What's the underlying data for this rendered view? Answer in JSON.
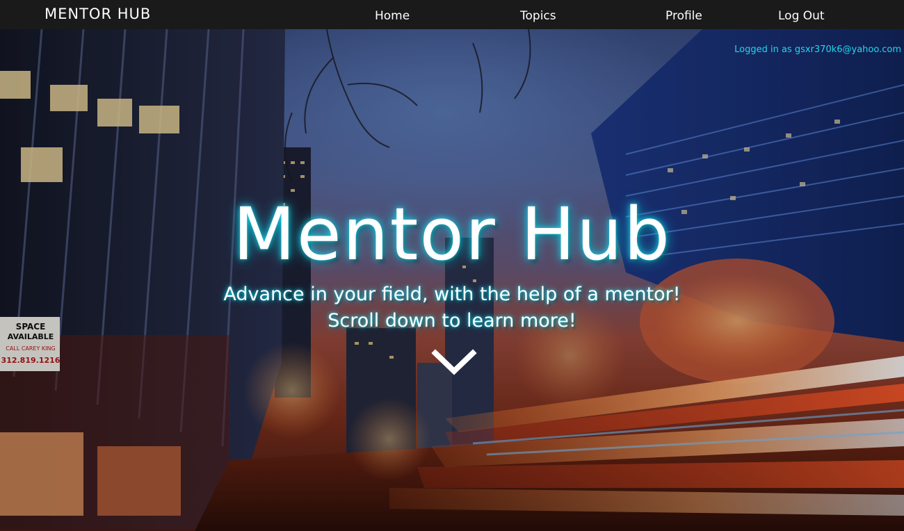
{
  "nav": {
    "brand": "MENTOR HUB",
    "links": [
      {
        "label": "Home"
      },
      {
        "label": "Topics"
      },
      {
        "label": "Profile"
      },
      {
        "label": "Log Out"
      }
    ]
  },
  "session": {
    "logged_in_text": "Logged in as gsxr370k6@yahoo.com"
  },
  "hero": {
    "title": "Mentor Hub",
    "tagline": "Advance in your field, with the help of a mentor!",
    "subtext": "Scroll down to learn more!",
    "scroll_icon": "chevron-down-icon",
    "background_image": "city street at night with light trails"
  },
  "colors": {
    "navbar_bg": "#1a1a1a",
    "accent_cyan": "#23d6ee",
    "text": "#ffffff"
  },
  "storefront_sign": {
    "line1": "SPACE",
    "line2": "AVAILABLE",
    "line3": "CALL CAREY KING",
    "line4": "312.819.1216"
  }
}
